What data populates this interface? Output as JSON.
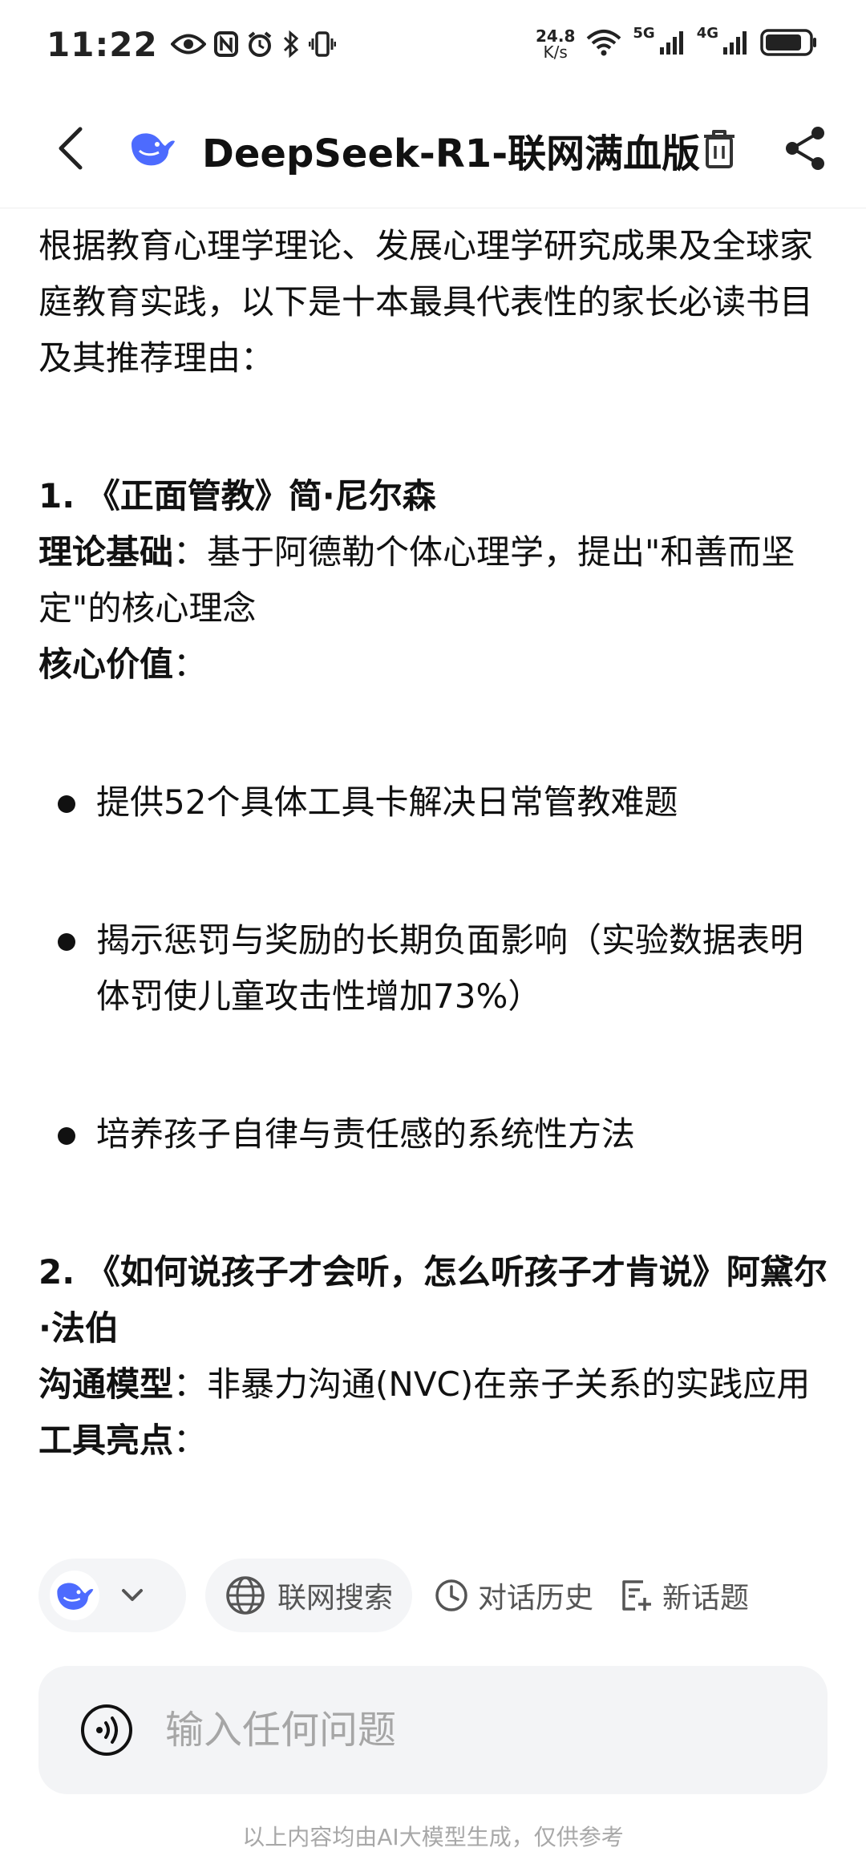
{
  "status_bar": {
    "time": "11:22",
    "net_speed_value": "24.8",
    "net_speed_unit": "K/s",
    "signal1_label": "5G",
    "signal2_label": "4G",
    "battery_level": 0.85,
    "icons": [
      "eye-icon",
      "nfc-icon",
      "alarm-icon",
      "bluetooth-icon",
      "vibrate-icon",
      "wifi-icon",
      "signal-icon",
      "battery-icon"
    ]
  },
  "header": {
    "title": "DeepSeek-R1-联网满血版",
    "icons": [
      "back-icon",
      "deepseek-logo-icon",
      "trash-icon",
      "share-icon"
    ]
  },
  "content": {
    "intro": "根据教育心理学理论、发展心理学研究成果及全球家庭教育实践，以下是十本最具代表性的家长必读书目及其推荐理由：",
    "book1": {
      "heading": "1. 《正面管教》简·尼尔森",
      "theory_label": "理论基础",
      "theory_text": "：基于阿德勒个体心理学，提出\"和善而坚定\"的核心理念",
      "value_label": "核心价值",
      "value_colon": "：",
      "bullets": [
        "提供52个具体工具卡解决日常管教难题",
        "揭示惩罚与奖励的长期负面影响（实验数据表明体罚使儿童攻击性增加73%）",
        "培养孩子自律与责任感的系统性方法"
      ]
    },
    "book2": {
      "heading": "2. 《如何说孩子才会听，怎么听孩子才肯说》阿黛尔·法伯",
      "model_label": "沟通模型",
      "model_text": "：非暴力沟通(NVC)在亲子关系的实践应用",
      "tools_label": "工具亮点",
      "tools_colon": "："
    }
  },
  "toolbar": {
    "web_search": "联网搜索",
    "history": "对话历史",
    "new_topic": "新话题"
  },
  "input": {
    "placeholder": "输入任何问题"
  },
  "footer": {
    "disclaimer": "以上内容均由AI大模型生成，仅供参考"
  },
  "colors": {
    "accent_blue": "#4D6BFE",
    "chip_bg": "#F4F5F7",
    "input_bg": "#F3F4F6",
    "muted_text": "#A8A8A8"
  }
}
